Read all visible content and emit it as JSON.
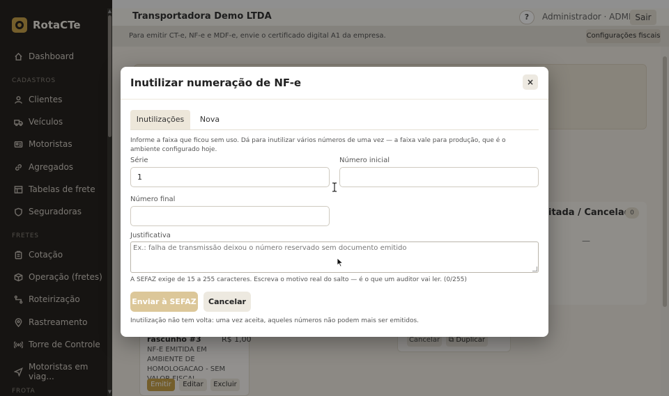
{
  "brand": {
    "name": "RotaCTe"
  },
  "sidebar": {
    "dashboard": {
      "label": "Dashboard",
      "icon": "home-icon"
    },
    "sections": [
      {
        "label": "CADASTROS"
      },
      {
        "label": "FRETES"
      },
      {
        "label": "FROTA"
      }
    ],
    "items": [
      {
        "label": "Clientes",
        "icon": "user-icon"
      },
      {
        "label": "Veículos",
        "icon": "truck-icon"
      },
      {
        "label": "Motoristas",
        "icon": "id-card-icon"
      },
      {
        "label": "Agregados",
        "icon": "link-icon"
      },
      {
        "label": "Tabelas de frete",
        "icon": "table-icon"
      },
      {
        "label": "Seguradoras",
        "icon": "shield-icon"
      },
      {
        "label": "Cotação",
        "icon": "clipboard-icon"
      },
      {
        "label": "Operação (fretes)",
        "icon": "box-icon"
      },
      {
        "label": "Roteirização",
        "icon": "route-icon"
      },
      {
        "label": "Rastreamento",
        "icon": "location-pin-icon"
      },
      {
        "label": "Torre de Controle",
        "icon": "broadcast-icon"
      },
      {
        "label": "Motoristas em viag...",
        "icon": "send-icon"
      }
    ]
  },
  "header": {
    "company": "Transportadora Demo LTDA",
    "help": "?",
    "user": "Administrador · ADMIN",
    "logout": "Sair"
  },
  "banner": {
    "text": "Para emitir CT-e, NF-e e MDF-e, envie o certificado digital A1 da empresa.",
    "button": "Configurações fiscais"
  },
  "background": {
    "column_title": "itada / Cancelada",
    "column_count": "0",
    "empty_dash": "—",
    "draft_title": "rascunho #3",
    "draft_price": "R$ 1,00",
    "draft_desc": "NF-E EMITIDA EM AMBIENTE DE HOMOLOGACAO - SEM VALOR FISCAL",
    "emit": "Emitir",
    "edit": "Editar",
    "delete": "Excluir",
    "cancel": "Cancelar",
    "duplicate": "⧉ Duplicar"
  },
  "modal": {
    "title": "Inutilizar numeração de NF-e",
    "close": "×",
    "tabs": [
      {
        "label": "Inutilizações"
      },
      {
        "label": "Nova"
      }
    ],
    "info": "Informe a faixa que ficou sem uso. Dá para inutilizar vários números de uma vez — a faixa vale para produção, que é o ambiente configurado hoje.",
    "serie": {
      "label": "Série",
      "value": "1"
    },
    "numero_inicial": {
      "label": "Número inicial",
      "value": ""
    },
    "numero_final": {
      "label": "Número final",
      "value": ""
    },
    "justificativa": {
      "label": "Justificativa",
      "placeholder": "Ex.: falha de transmissão deixou o número reservado sem documento emitido"
    },
    "hint": "A SEFAZ exige de 15 a 255 caracteres. Escreva o motivo real do salto — é o que um auditor vai ler. (0/255)",
    "submit": "Enviar à SEFAZ",
    "cancel": "Cancelar",
    "footnote": "Inutilização não tem volta: uma vez aceita, aqueles números não podem mais ser emitidos."
  },
  "colors": {
    "sidebar_bg": "#262320",
    "accent": "#c9a24b",
    "submit_disabled": "#dcc799",
    "overlay": "rgba(0,0,0,0.42)"
  }
}
